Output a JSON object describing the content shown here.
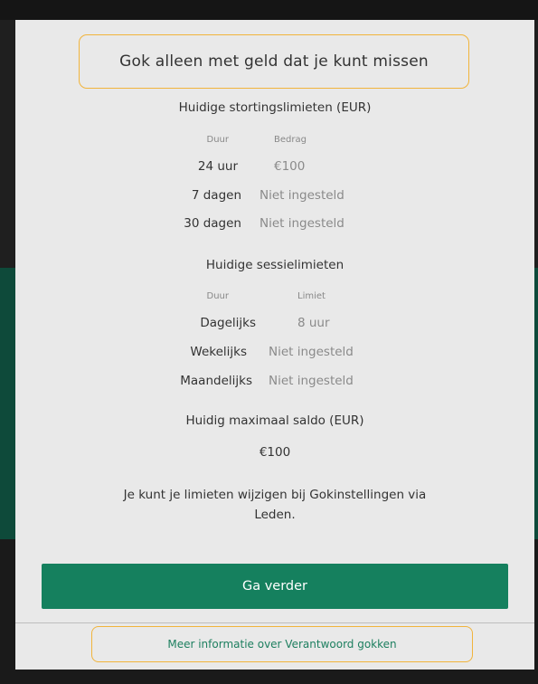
{
  "warning_banner": "Gok alleen met geld dat je kunt missen",
  "deposit_limits": {
    "title": "Huidige stortingslimieten (EUR)",
    "col_duration": "Duur",
    "col_amount": "Bedrag",
    "rows": [
      {
        "period": "24 uur",
        "value": "€100"
      },
      {
        "period": "7 dagen",
        "value": "Niet ingesteld"
      },
      {
        "period": "30 dagen",
        "value": "Niet ingesteld"
      }
    ]
  },
  "session_limits": {
    "title": "Huidige sessielimieten",
    "col_duration": "Duur",
    "col_limit": "Limiet",
    "rows": [
      {
        "period": "Dagelijks",
        "value": "8 uur"
      },
      {
        "period": "Wekelijks",
        "value": "Niet ingesteld"
      },
      {
        "period": "Maandelijks",
        "value": "Niet ingesteld"
      }
    ]
  },
  "max_balance": {
    "title": "Huidig maximaal saldo (EUR)",
    "value": "€100"
  },
  "info_text_line1": "Je kunt je limieten wijzigen bij Gokinstellingen via",
  "info_text_line2": "Leden.",
  "continue_button": "Ga verder",
  "more_info_link": "Meer informatie over Verantwoord gokken",
  "colors": {
    "accent_green": "#15805e",
    "highlight_border": "#f1b43c",
    "modal_bg": "#e9e9e9"
  }
}
